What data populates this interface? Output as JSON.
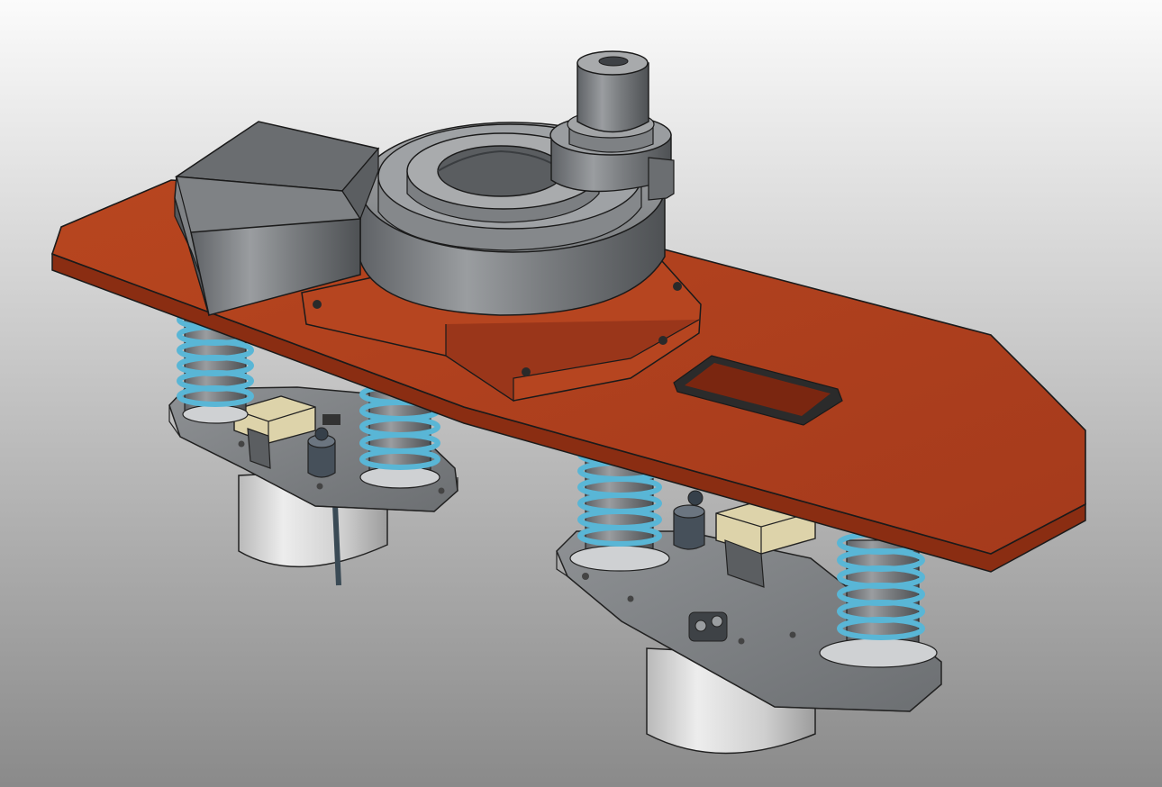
{
  "viewport": {
    "background_top": "#fbfbfb",
    "background_bottom": "#8a8a8a"
  },
  "model": {
    "colors": {
      "plate": "#b0401f",
      "plate_side": "#8a2d12",
      "plate_light": "#c45a37",
      "steel": "#8a8d90",
      "steel_dark": "#55585b",
      "steel_light": "#c9cacb",
      "spring": "#59b6d6",
      "sensor_body": "#ddd3aa",
      "motor": "#d4d4d4",
      "outline": "#1a1a1a"
    },
    "parts": [
      "mounting-plate",
      "rotary-bearing-housing",
      "shaft-collar",
      "wedge-block",
      "coil-spring",
      "bracket-plate",
      "load-cell",
      "motor-can"
    ]
  }
}
